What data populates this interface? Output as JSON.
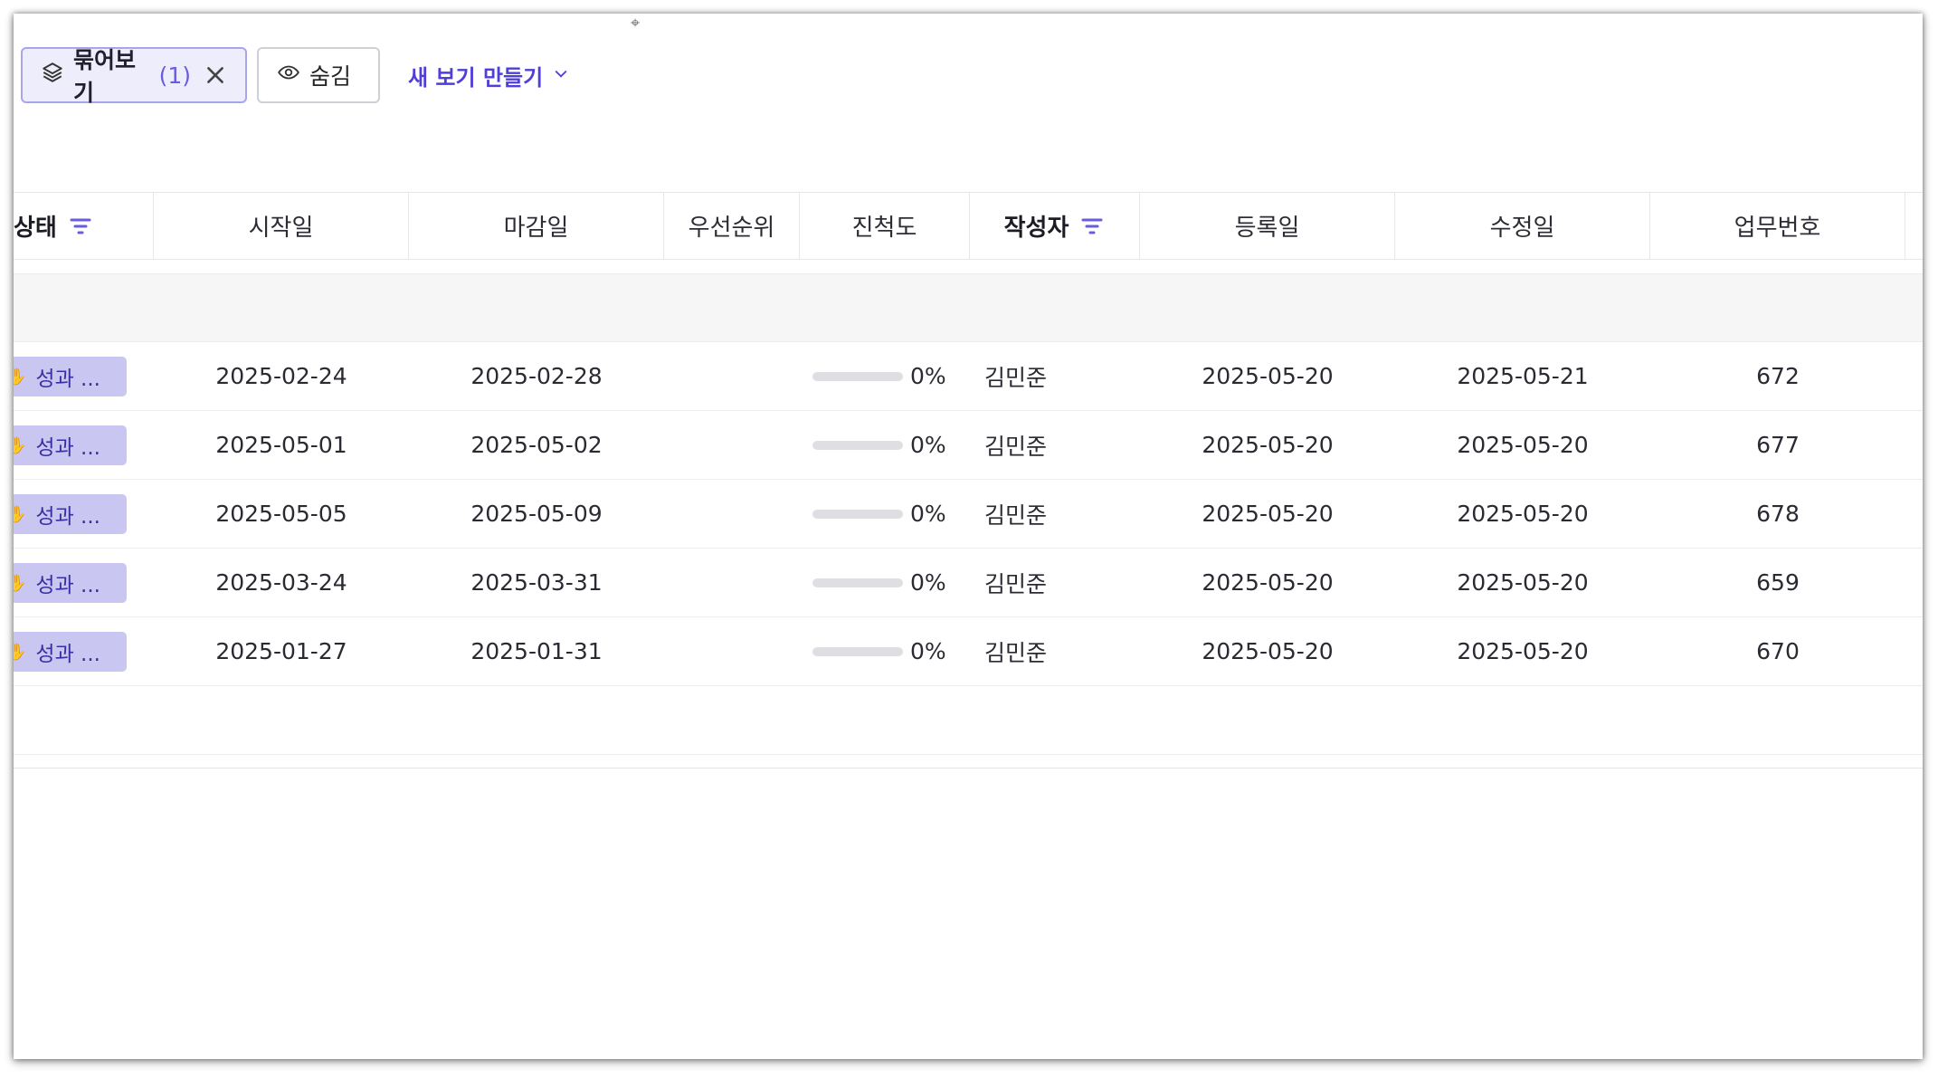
{
  "toolbar": {
    "group_chip": {
      "label": "묶어보기",
      "count": "(1)"
    },
    "hide_chip": {
      "label": "숨김"
    },
    "new_view": {
      "label": "새 보기 만들기"
    }
  },
  "table": {
    "columns": [
      {
        "label": "상태",
        "filtered": true
      },
      {
        "label": "시작일"
      },
      {
        "label": "마감일"
      },
      {
        "label": "우선순위"
      },
      {
        "label": "진척도"
      },
      {
        "label": "작성자",
        "filtered": true
      },
      {
        "label": "등록일"
      },
      {
        "label": "수정일"
      },
      {
        "label": "업무번호"
      }
    ],
    "rows": [
      {
        "status": "성과 ...",
        "start": "2025-02-24",
        "due": "2025-02-28",
        "priority": "",
        "progress": "0%",
        "progress_value": 0,
        "author": "김민준",
        "created": "2025-05-20",
        "modified": "2025-05-21",
        "task_no": "672"
      },
      {
        "status": "성과 ...",
        "start": "2025-05-01",
        "due": "2025-05-02",
        "priority": "",
        "progress": "0%",
        "progress_value": 0,
        "author": "김민준",
        "created": "2025-05-20",
        "modified": "2025-05-20",
        "task_no": "677"
      },
      {
        "status": "성과 ...",
        "start": "2025-05-05",
        "due": "2025-05-09",
        "priority": "",
        "progress": "0%",
        "progress_value": 0,
        "author": "김민준",
        "created": "2025-05-20",
        "modified": "2025-05-20",
        "task_no": "678"
      },
      {
        "status": "성과 ...",
        "start": "2025-03-24",
        "due": "2025-03-31",
        "priority": "",
        "progress": "0%",
        "progress_value": 0,
        "author": "김민준",
        "created": "2025-05-20",
        "modified": "2025-05-20",
        "task_no": "659"
      },
      {
        "status": "성과 ...",
        "start": "2025-01-27",
        "due": "2025-01-31",
        "priority": "",
        "progress": "0%",
        "progress_value": 0,
        "author": "김민준",
        "created": "2025-05-20",
        "modified": "2025-05-20",
        "task_no": "670"
      }
    ]
  },
  "colors": {
    "accent": "#6a5ce0",
    "status_pill": "#cac6f2",
    "link": "#4f3fd8"
  },
  "icons": {
    "group": "layers-icon",
    "remove": "close-icon",
    "hide": "eye-icon",
    "dropdown": "chevron-down-icon",
    "filter": "filter-icon",
    "status": "hand-icon"
  }
}
